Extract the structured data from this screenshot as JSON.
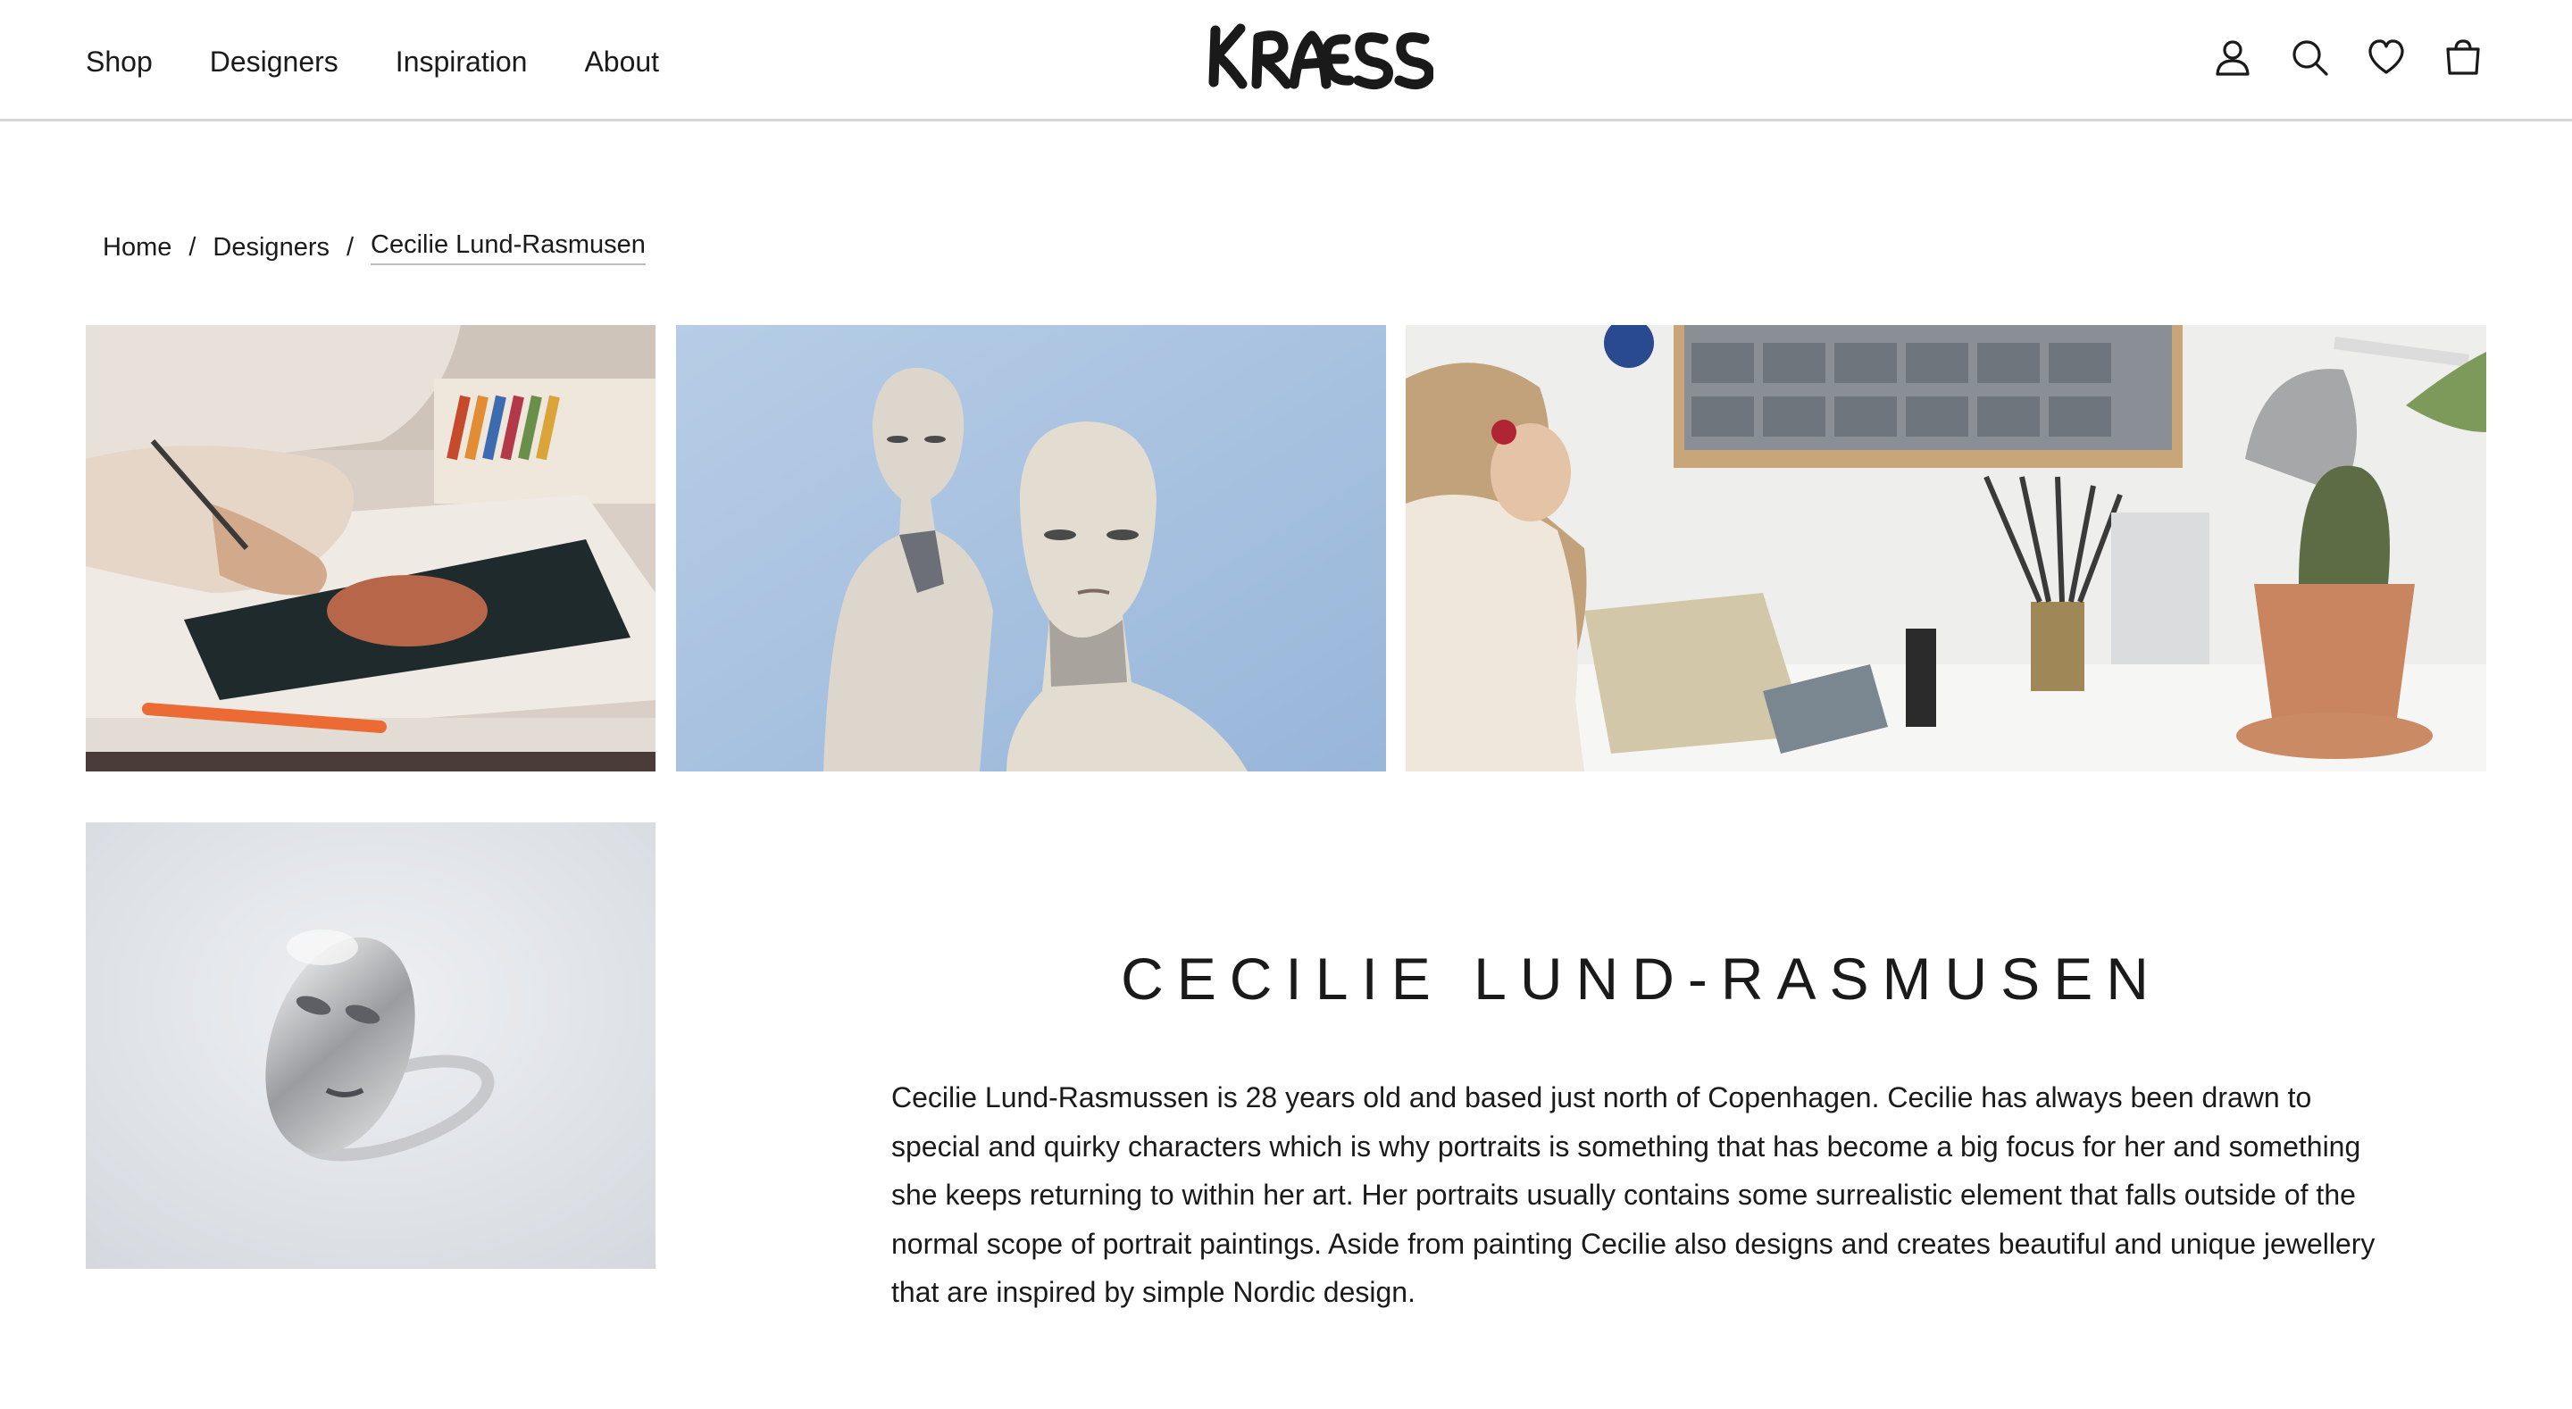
{
  "nav": {
    "items": [
      "Shop",
      "Designers",
      "Inspiration",
      "About"
    ]
  },
  "brand": {
    "logo_text": "KRAESS"
  },
  "header_icons": [
    "account-icon",
    "search-icon",
    "wishlist-heart-icon",
    "shopping-bag-icon"
  ],
  "breadcrumb": {
    "home": "Home",
    "separator": "/",
    "designers": "Designers",
    "current": "Cecilie Lund-Rasmusen"
  },
  "designer": {
    "name": "CECILIE LUND-RASMUSEN",
    "bio": "Cecilie Lund-Rasmussen is 28 years old and based just north of Copenhagen. Cecilie has always been drawn to special and quirky characters which is why portraits is something that has become a big focus for her and something she keeps returning to within her art. Her portraits usually contains some surrealistic element that falls outside of the normal scope of portrait paintings. Aside from painting Cecilie also designs and creates beautiful and unique jewellery that are inspired by simple Nordic design."
  },
  "colors": {
    "text": "#1a1a1a",
    "divider": "#d6d6d6",
    "painting_blue": "#a9c3e0"
  }
}
